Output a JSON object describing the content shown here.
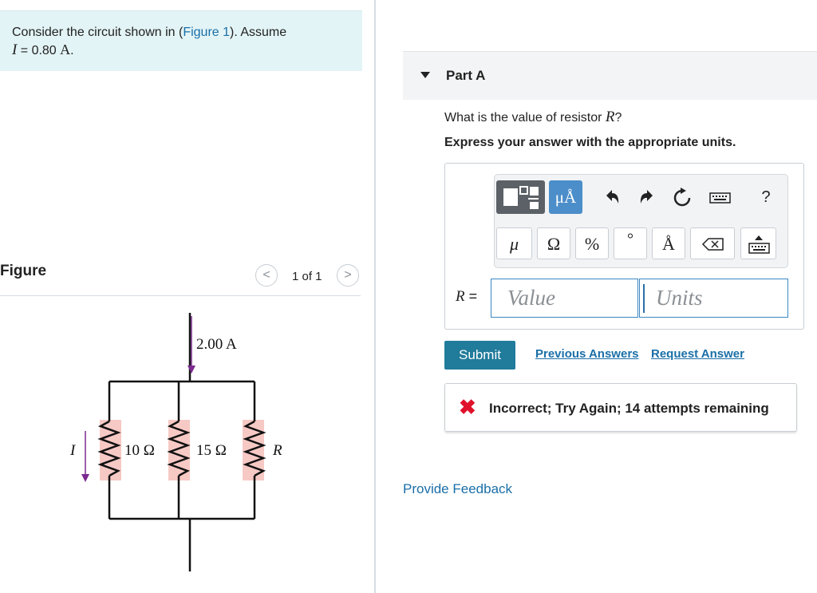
{
  "problem": {
    "text_before_link": "Consider the circuit shown in (",
    "figure_link": "Figure 1",
    "text_after_link": "). Assume",
    "var": "I",
    "eq": " = 0.80 ",
    "unit": "A",
    "period": "."
  },
  "figure": {
    "heading": "Figure",
    "prev_icon": "chevron-left-icon",
    "next_icon": "chevron-right-icon",
    "prev_glyph": "<",
    "next_glyph": ">",
    "page_text": "1 of 1"
  },
  "circuit": {
    "current_top": "2.00 A",
    "current_left": "I",
    "r1": "10 Ω",
    "r2": "15 Ω",
    "r3": "R",
    "wire_color": "#111111",
    "arrow_color": "#7b2a8e",
    "resistor_bg": "#f7c9c5"
  },
  "part": {
    "label": "Part A",
    "question_before": "What is the value of resistor ",
    "question_var": "R",
    "question_after": "?",
    "instruction": "Express your answer with the appropriate units."
  },
  "toolbar": {
    "templates_icon": "templates-icon",
    "units_label": "μÅ",
    "undo_icon": "undo-icon",
    "redo_icon": "redo-icon",
    "reset_icon": "reset-icon",
    "keyboard_icon": "keyboard-icon",
    "help_label": "?",
    "symbols": [
      "μ",
      "Ω",
      "%",
      "°",
      "Å"
    ],
    "delete_icon": "backspace-icon",
    "keyboard_toggle_icon": "keyboard-toggle-icon"
  },
  "answer": {
    "label_var": "R",
    "label_eq": " =",
    "value_placeholder": "Value",
    "units_placeholder": "Units"
  },
  "actions": {
    "submit": "Submit",
    "previous_answers": "Previous Answers",
    "request_answer": "Request Answer"
  },
  "feedback": {
    "icon": "x-icon",
    "glyph": "✖",
    "text": "Incorrect; Try Again; 14 attempts remaining",
    "color": "#e0112b"
  },
  "provide_feedback": "Provide Feedback",
  "colors": {
    "accent": "#217b9b",
    "link": "#1a6fa8",
    "problem_bg": "#e3f4f6"
  }
}
